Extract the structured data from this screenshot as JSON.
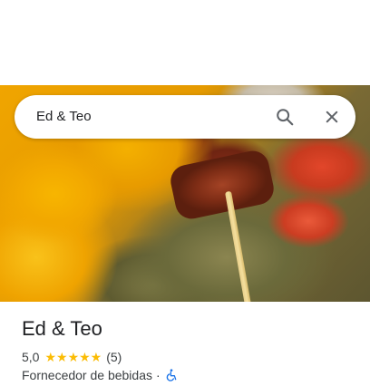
{
  "search": {
    "query": "Ed & Teo"
  },
  "place": {
    "name": "Ed & Teo",
    "rating": "5,0",
    "stars": "★★★★★",
    "review_count": "(5)",
    "category": "Fornecedor de bebidas",
    "separator": "·"
  },
  "colors": {
    "star": "#fbbc04",
    "accessibility_icon": "#1a73e8",
    "text_primary": "#202124",
    "text_secondary": "#3c4043"
  },
  "icons": {
    "search": "search-icon",
    "close": "close-icon",
    "accessibility": "wheelchair-icon"
  }
}
